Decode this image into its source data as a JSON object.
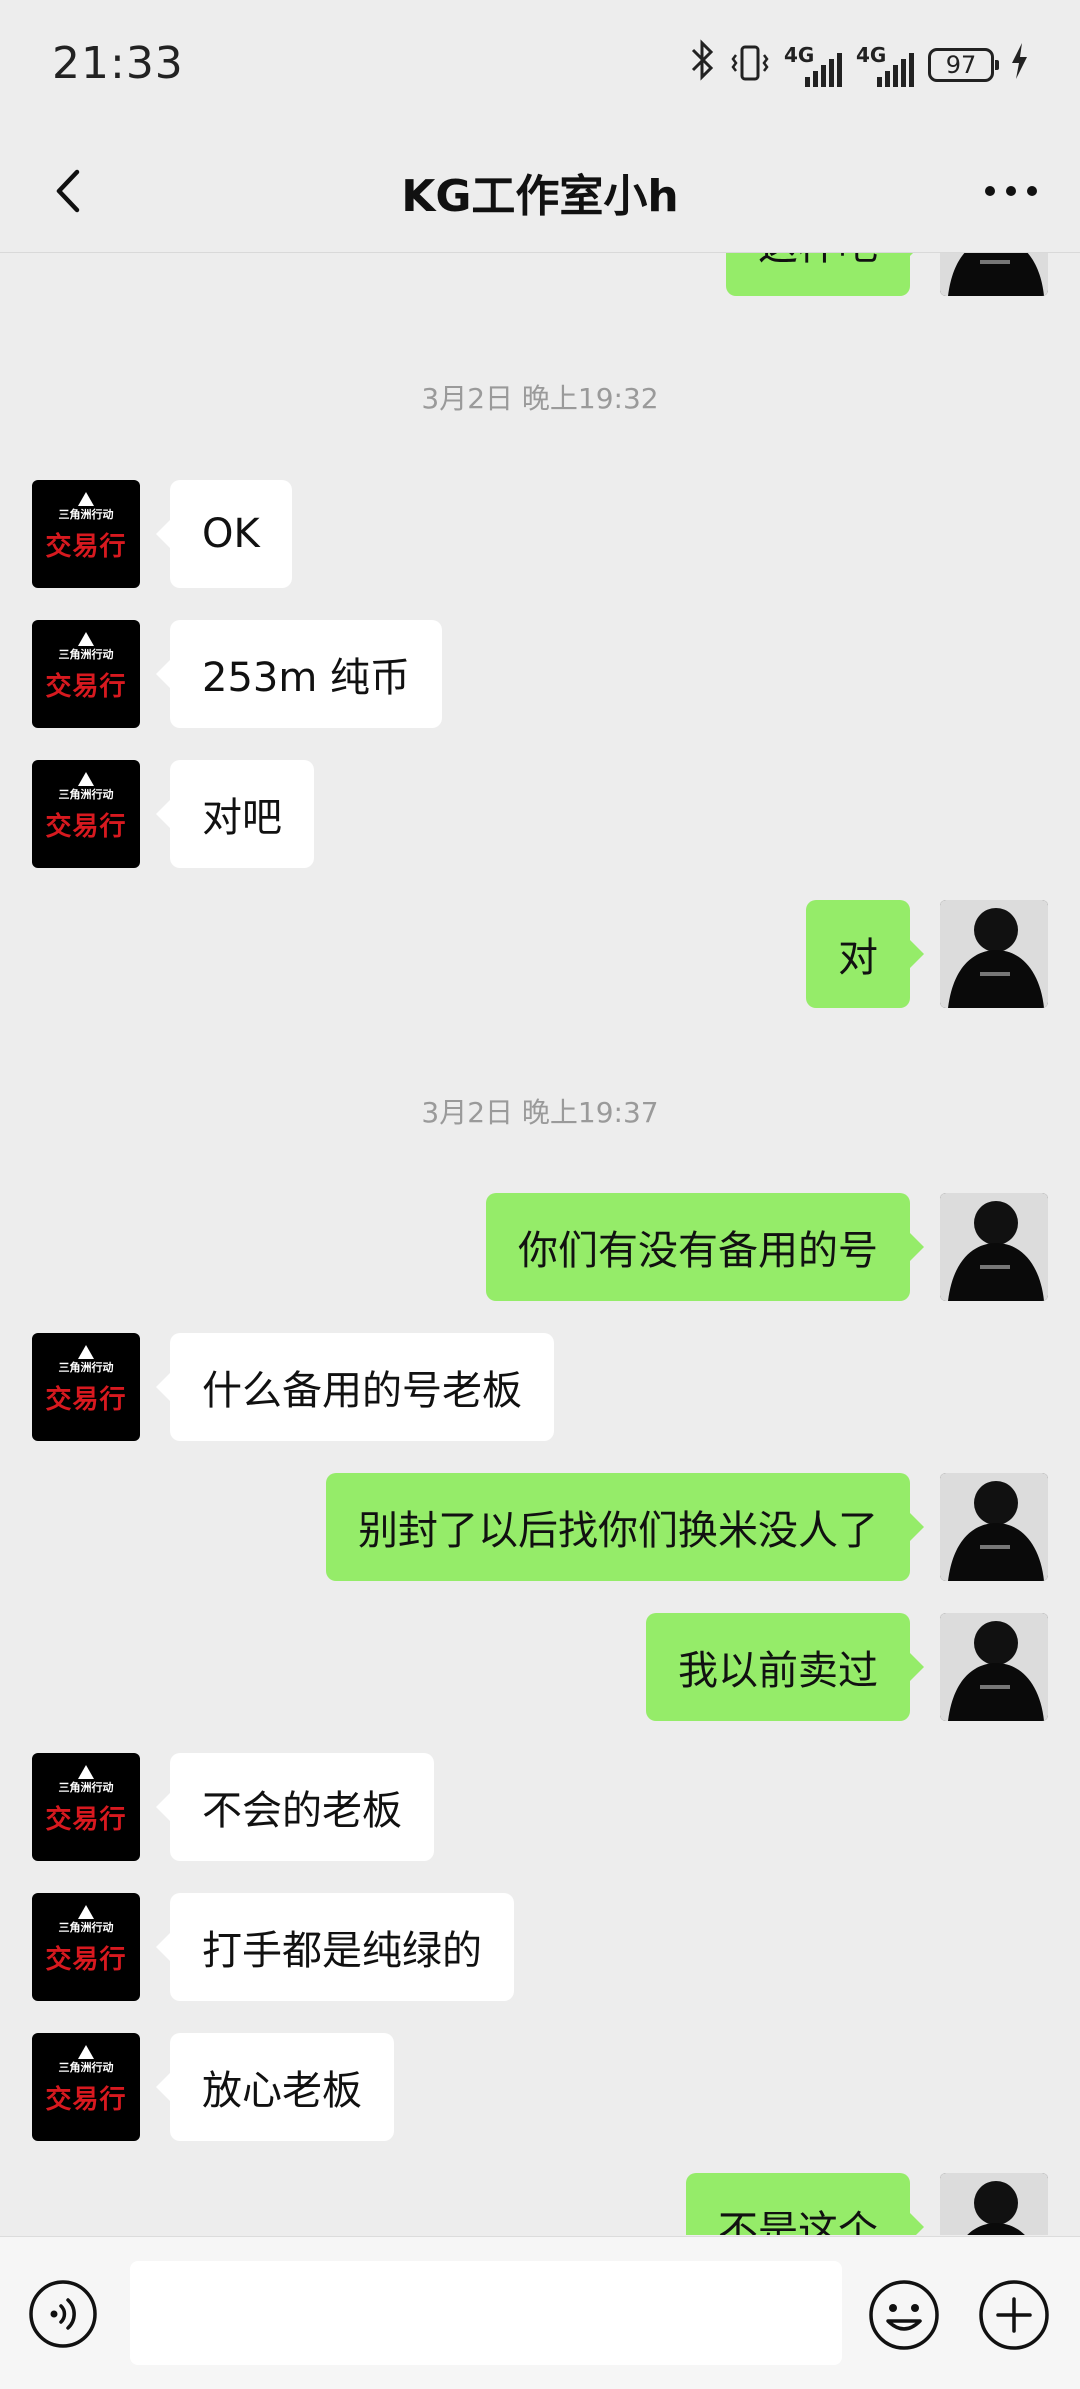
{
  "status_bar": {
    "time": "21:33",
    "network_1": "4G",
    "network_2": "4G",
    "battery": "97"
  },
  "header": {
    "title": "KG工作室小h"
  },
  "avatar_logo": {
    "top_text": "三角洲行动",
    "main_text": "交易行"
  },
  "messages": [
    {
      "type": "out",
      "text": "这样吧"
    },
    {
      "type": "time",
      "text": "3月2日 晚上19:32"
    },
    {
      "type": "in",
      "text": "OK"
    },
    {
      "type": "in",
      "text": "253m 纯币"
    },
    {
      "type": "in",
      "text": "对吧"
    },
    {
      "type": "out",
      "text": "对"
    },
    {
      "type": "time",
      "text": "3月2日 晚上19:37"
    },
    {
      "type": "out",
      "text": "你们有没有备用的号"
    },
    {
      "type": "in",
      "text": "什么备用的号老板"
    },
    {
      "type": "out",
      "text": "别封了以后找你们换米没人了"
    },
    {
      "type": "out",
      "text": "我以前卖过"
    },
    {
      "type": "in",
      "text": "不会的老板"
    },
    {
      "type": "in",
      "text": "打手都是纯绿的"
    },
    {
      "type": "in",
      "text": "放心老板"
    },
    {
      "type": "out",
      "text": "不是这个"
    }
  ],
  "input": {
    "value": "",
    "placeholder": ""
  },
  "colors": {
    "background": "#ededed",
    "bubble_out": "#95ec69",
    "bubble_in": "#ffffff",
    "logo_red": "#d7191f"
  },
  "icons": [
    "back-arrow-icon",
    "more-dots-icon",
    "voice-icon",
    "emoji-icon",
    "plus-icon",
    "bluetooth-icon",
    "vibrate-icon",
    "signal-icon",
    "battery-icon",
    "charging-icon"
  ]
}
